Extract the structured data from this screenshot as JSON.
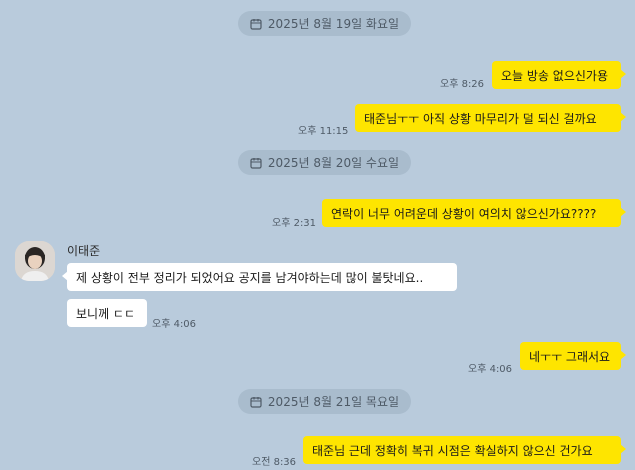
{
  "dates": [
    "2025년 8월 19일 화요일",
    "2025년 8월 20일 수요일",
    "2025년 8월 21일 목요일"
  ],
  "sender_name": "이태준",
  "messages": [
    {
      "text": "오늘 방송 없으신가용",
      "time": "오후 8:26",
      "from": "me"
    },
    {
      "text": "태준님ㅜㅜ 아직 상황 마무리가 덜 되신 걸까요",
      "time": "오후 11:15",
      "from": "me"
    },
    {
      "text": "연락이 너무 어려운데 상황이 여의치 않으신가요????",
      "time": "오후 2:31",
      "from": "me"
    },
    {
      "text": "제 상황이 전부 정리가 되었어요 공지를 남겨야하는데 많이 불탓네요..",
      "from": "other"
    },
    {
      "text": "보니께 ㄷㄷ",
      "time": "오후 4:06",
      "from": "other"
    },
    {
      "text": "네ㅜㅜ 그래서요",
      "time": "오후 4:06",
      "from": "me"
    },
    {
      "text": "태준님 근데 정확히 복귀 시점은 확실하지 않으신 건가요",
      "time": "오전 8:36",
      "from": "me"
    }
  ],
  "icons": {
    "date": "calendar-icon",
    "avatar": "profile-avatar"
  },
  "colors": {
    "background": "#b9cbdc",
    "my_bubble": "#fee500",
    "other_bubble": "#ffffff"
  }
}
